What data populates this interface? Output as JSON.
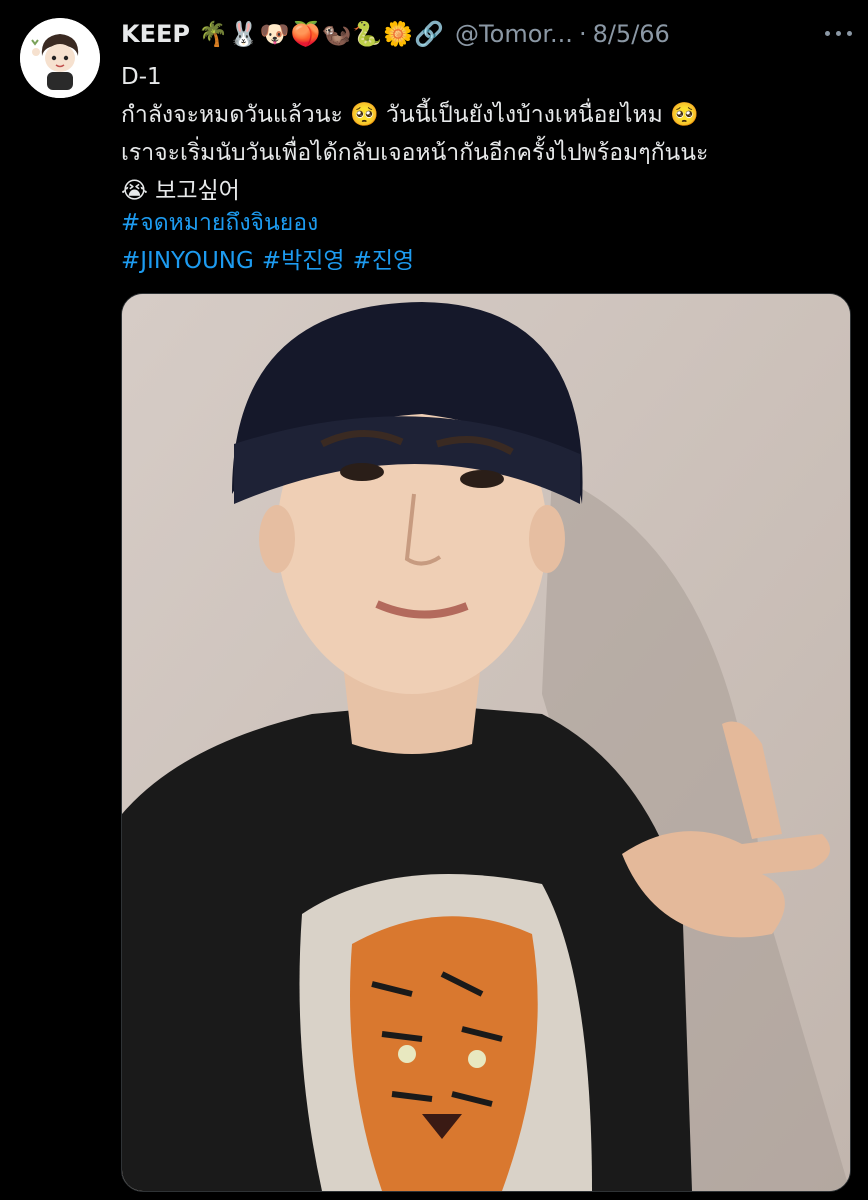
{
  "tweet": {
    "display_name": "KEEP",
    "name_emojis": "🌴🐰🐶🍑🦦🐍🌼🔗",
    "handle": "@Tomor...",
    "separator": "·",
    "date": "8/5/66",
    "avatar_icon": "cartoon-boy-avatar-icon",
    "more_icon": "ellipsis-icon",
    "text_lines": [
      "D-1",
      "กำลังจะหมดวันแล้วนะ 🥺 วันนี้เป็นยังไงบ้างเหนื่อยไหม 🥺",
      "เราจะเริ่มนับวันเพื่อได้กลับเจอหน้ากันอีกครั้งไปพร้อมๆกันนะ",
      "😭 보고싶어"
    ],
    "hashtags_line1": [
      "#จดหมายถึงจินยอง"
    ],
    "hashtags_line2": [
      "#JINYOUNG",
      "#박진영",
      "#진영"
    ]
  },
  "colors": {
    "background": "#000000",
    "text": "#e7e9ea",
    "muted": "#8b98a5",
    "link": "#1d9bf0"
  },
  "media": {
    "description_icon": "photo-man-beanie-tiger-shirt-icon"
  }
}
